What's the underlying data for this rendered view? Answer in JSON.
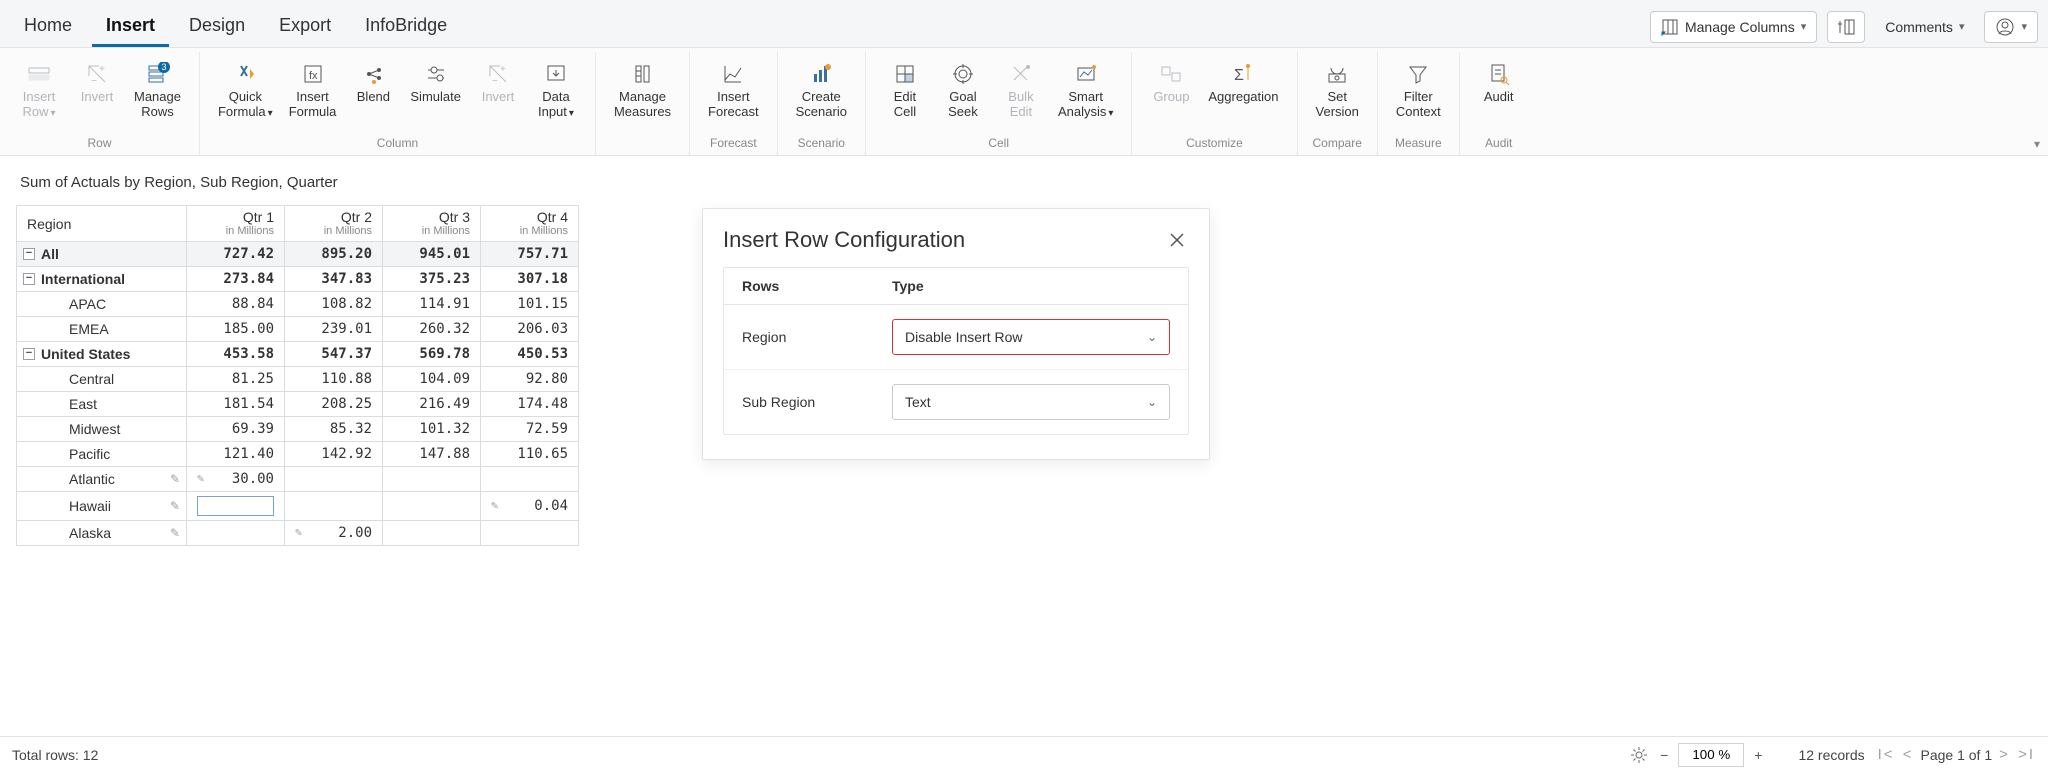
{
  "tabs": [
    "Home",
    "Insert",
    "Design",
    "Export",
    "InfoBridge"
  ],
  "active_tab_index": 1,
  "topbar": {
    "manage_columns": "Manage Columns",
    "comments": "Comments"
  },
  "ribbon": {
    "groups": [
      {
        "label": "Row",
        "buttons": [
          {
            "line1": "Insert",
            "line2": "Row",
            "chev": true,
            "disabled": true,
            "icon": "insert-row"
          },
          {
            "line1": "Invert",
            "line2": "",
            "disabled": true,
            "icon": "invert"
          },
          {
            "line1": "Manage",
            "line2": "Rows",
            "icon": "manage-rows",
            "badge": "3"
          }
        ]
      },
      {
        "label": "Column",
        "buttons": [
          {
            "line1": "Quick",
            "line2": "Formula",
            "chev": true,
            "icon": "quick-formula"
          },
          {
            "line1": "Insert",
            "line2": "Formula",
            "icon": "insert-formula"
          },
          {
            "line1": "Blend",
            "line2": "",
            "icon": "blend"
          },
          {
            "line1": "Simulate",
            "line2": "",
            "icon": "simulate"
          },
          {
            "line1": "Invert",
            "line2": "",
            "disabled": true,
            "icon": "invert2"
          },
          {
            "line1": "Data",
            "line2": "Input",
            "chev": true,
            "icon": "data-input"
          }
        ]
      },
      {
        "label": "",
        "buttons": [
          {
            "line1": "Manage",
            "line2": "Measures",
            "icon": "manage-measures"
          }
        ]
      },
      {
        "label": "Forecast",
        "buttons": [
          {
            "line1": "Insert",
            "line2": "Forecast",
            "icon": "insert-forecast"
          }
        ]
      },
      {
        "label": "Scenario",
        "buttons": [
          {
            "line1": "Create",
            "line2": "Scenario",
            "icon": "create-scenario"
          }
        ]
      },
      {
        "label": "Cell",
        "buttons": [
          {
            "line1": "Edit",
            "line2": "Cell",
            "icon": "edit-cell"
          },
          {
            "line1": "Goal",
            "line2": "Seek",
            "icon": "goal-seek"
          },
          {
            "line1": "Bulk",
            "line2": "Edit",
            "disabled": true,
            "icon": "bulk-edit"
          },
          {
            "line1": "Smart",
            "line2": "Analysis",
            "chev": true,
            "icon": "smart-analysis"
          }
        ]
      },
      {
        "label": "Customize",
        "buttons": [
          {
            "line1": "Group",
            "line2": "",
            "disabled": true,
            "icon": "group"
          },
          {
            "line1": "Aggregation",
            "line2": "",
            "icon": "aggregation"
          }
        ]
      },
      {
        "label": "Compare",
        "buttons": [
          {
            "line1": "Set",
            "line2": "Version",
            "icon": "set-version"
          }
        ]
      },
      {
        "label": "Measure",
        "buttons": [
          {
            "line1": "Filter",
            "line2": "Context",
            "icon": "filter-context"
          }
        ]
      },
      {
        "label": "Audit",
        "buttons": [
          {
            "line1": "Audit",
            "line2": "",
            "icon": "audit"
          }
        ]
      }
    ]
  },
  "table_title": "Sum of Actuals by Region, Sub Region, Quarter",
  "quarters": [
    "Qtr 1",
    "Qtr 2",
    "Qtr 3",
    "Qtr 4"
  ],
  "quarter_sub": "in Millions",
  "region_header": "Region",
  "rows": [
    {
      "type": "all",
      "label": "All",
      "vals": [
        "727.42",
        "895.20",
        "945.01",
        "757.71"
      ]
    },
    {
      "type": "group",
      "label": "International",
      "vals": [
        "273.84",
        "347.83",
        "375.23",
        "307.18"
      ]
    },
    {
      "type": "leaf",
      "label": "APAC",
      "vals": [
        "88.84",
        "108.82",
        "114.91",
        "101.15"
      ]
    },
    {
      "type": "leaf",
      "label": "EMEA",
      "vals": [
        "185.00",
        "239.01",
        "260.32",
        "206.03"
      ]
    },
    {
      "type": "group",
      "label": "United States",
      "vals": [
        "453.58",
        "547.37",
        "569.78",
        "450.53"
      ]
    },
    {
      "type": "leaf",
      "label": "Central",
      "vals": [
        "81.25",
        "110.88",
        "104.09",
        "92.80"
      ]
    },
    {
      "type": "leaf",
      "label": "East",
      "vals": [
        "181.54",
        "208.25",
        "216.49",
        "174.48"
      ]
    },
    {
      "type": "leaf",
      "label": "Midwest",
      "vals": [
        "69.39",
        "85.32",
        "101.32",
        "72.59"
      ]
    },
    {
      "type": "leaf",
      "label": "Pacific",
      "vals": [
        "121.40",
        "142.92",
        "147.88",
        "110.65"
      ]
    },
    {
      "type": "new",
      "label": "Atlantic",
      "vals": [
        "30.00",
        "",
        "",
        ""
      ],
      "pencil": true,
      "cell_pencil": [
        false,
        true,
        false,
        false,
        false
      ]
    },
    {
      "type": "new",
      "label": "Hawaii",
      "vals": [
        "",
        "",
        "",
        "0.04"
      ],
      "pencil": true,
      "active": 0,
      "cell_pencil": [
        false,
        false,
        false,
        false,
        true
      ]
    },
    {
      "type": "new",
      "label": "Alaska",
      "vals": [
        "",
        "2.00",
        "",
        ""
      ],
      "pencil": true,
      "cell_pencil": [
        false,
        false,
        true,
        false,
        false
      ]
    }
  ],
  "panel": {
    "title": "Insert Row Configuration",
    "col_rows": "Rows",
    "col_type": "Type",
    "rows": [
      {
        "label": "Region",
        "value": "Disable Insert Row",
        "alert": true
      },
      {
        "label": "Sub Region",
        "value": "Text",
        "alert": false
      }
    ]
  },
  "status": {
    "total_rows": "Total rows: 12",
    "zoom": "100 %",
    "records": "12 records",
    "page": "Page 1 of 1"
  }
}
